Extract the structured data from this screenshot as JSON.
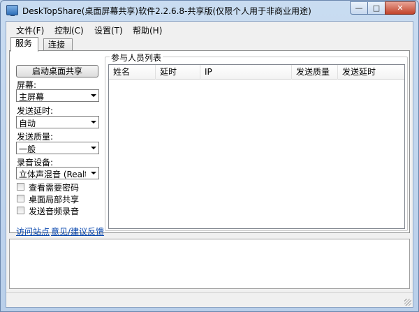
{
  "window": {
    "title": "DeskTopShare(桌面屏幕共享)软件2.2.6.8-共享版(仅限个人用于非商业用途)",
    "minimize": "—",
    "maximize": "□",
    "close": "✕"
  },
  "menu": {
    "items": [
      "文件(F)",
      "控制(C)",
      "设置(T)",
      "帮助(H)"
    ]
  },
  "tabs": [
    "服务",
    "连接"
  ],
  "service": {
    "start_button": "启动桌面共享",
    "screen_label": "屏幕:",
    "screen_value": "主屏幕",
    "delay_label": "发送延时:",
    "delay_value": "自动",
    "quality_label": "发送质量:",
    "quality_value": "一般",
    "audio_label": "录音设备:",
    "audio_value": "立体声混音 (Realtek",
    "checkboxes": [
      "查看需要密码",
      "桌面局部共享",
      "发送音频录音"
    ],
    "links": [
      "访问站点",
      "意见/建议反馈"
    ]
  },
  "participants": {
    "title": "参与人员列表",
    "columns": [
      "姓名",
      "延时",
      "IP",
      "发送质量",
      "发送延时"
    ]
  },
  "colors": {
    "titlebar": "#c9dcf1",
    "close_button": "#c1432a",
    "link": "#0645ad"
  }
}
